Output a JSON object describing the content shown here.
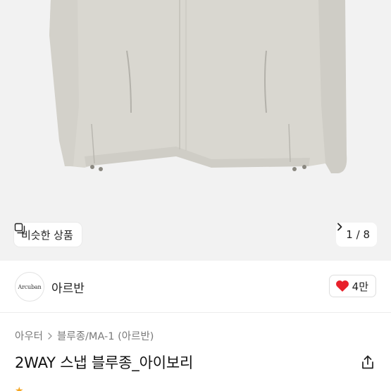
{
  "similar_button": {
    "label": "비슷한 상품"
  },
  "pager": {
    "current": "1",
    "total": "8",
    "separator": "/"
  },
  "shop": {
    "logo_text": "Arcuban",
    "name": "아르반"
  },
  "like": {
    "count": "4만"
  },
  "breadcrumb": {
    "items": [
      "아우터",
      "블루종/MA-1 (아르반)"
    ]
  },
  "product": {
    "title": "2WAY 스냅 블루종_아이보리"
  },
  "colors": {
    "hero_bg": "#f2f2f2",
    "jacket": "#d8d6cf",
    "heart": "#e8202a"
  }
}
